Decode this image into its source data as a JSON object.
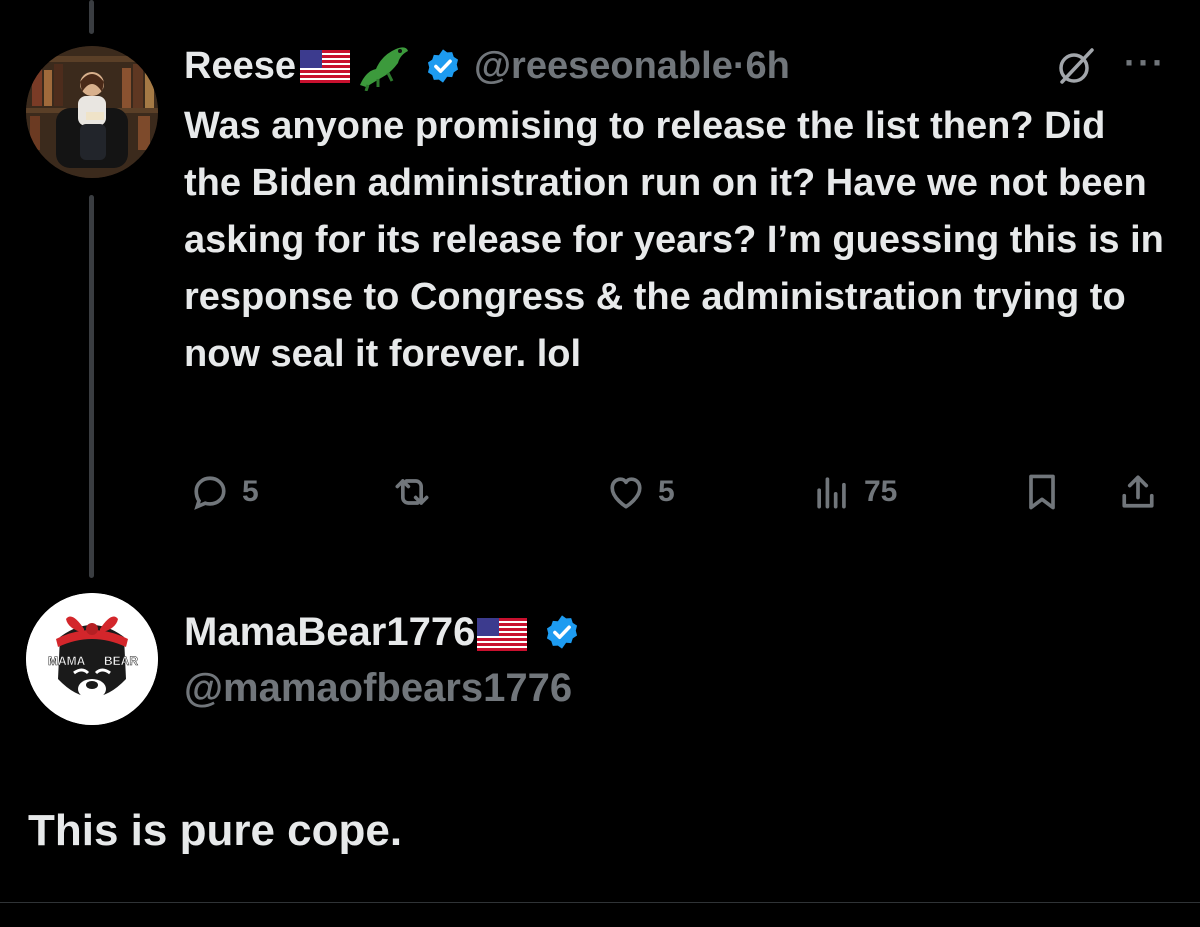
{
  "tweet": {
    "author_name": "Reese",
    "handle": "@reeseonable",
    "separator": "·",
    "time": "6h",
    "text": "Was anyone promising to release the list then? Did the Biden administration run on it? Have we not been asking for its release for years? I’m guessing this is in response to Congress & the administration trying to now seal it forever. lol",
    "more_label": "···",
    "actions": {
      "replies": "5",
      "likes": "5",
      "views": "75"
    }
  },
  "reply": {
    "author_name": "MamaBear1776",
    "handle": "@mamaofbears1776",
    "text": "This is pure cope.",
    "avatar_lettering": "MAMA BEAR"
  },
  "colors": {
    "background": "#000000",
    "text": "#e7e9ea",
    "muted": "#71767b",
    "verified": "#1d9bf0",
    "thread_line": "#3a3d41"
  },
  "icons": [
    "flag-us-icon",
    "crocodile-icon",
    "verified-badge-icon",
    "grok-icon",
    "more-icon",
    "reply-icon",
    "retweet-icon",
    "like-icon",
    "views-icon",
    "bookmark-icon",
    "share-icon"
  ]
}
